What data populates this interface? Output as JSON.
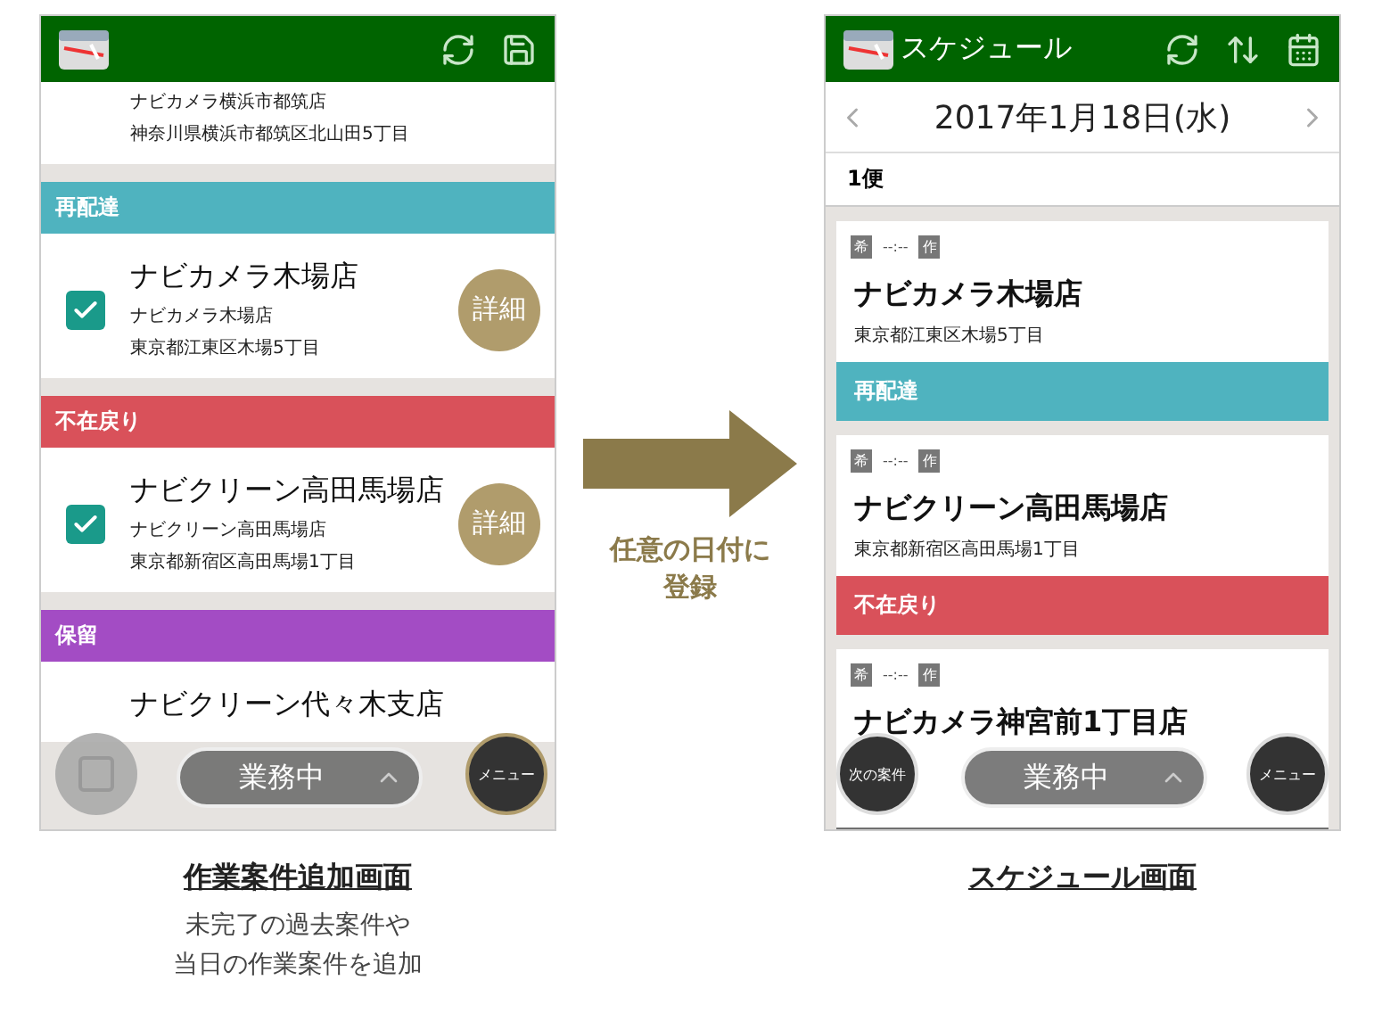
{
  "left_screen": {
    "cards": [
      {
        "name": "ナビカメラ横浜市都筑店",
        "address": "神奈川県横浜市都筑区北山田5丁目"
      },
      {
        "section": "再配達",
        "color": "#4fb3bf",
        "title": "ナビカメラ木場店",
        "name": "ナビカメラ木場店",
        "address": "東京都江東区木場5丁目",
        "checked": true,
        "detail": "詳細"
      },
      {
        "section": "不在戻り",
        "color": "#d9515a",
        "title": "ナビクリーン高田馬場店",
        "name": "ナビクリーン高田馬場店",
        "address": "東京都新宿区高田馬場1丁目",
        "checked": true,
        "detail": "詳細"
      },
      {
        "section": "保留",
        "color": "#a34cc4",
        "title": "ナビクリーン代々木支店"
      }
    ],
    "status_pill": "業務中",
    "menu_button": "メニュー"
  },
  "arrow_label": [
    "任意の日付に",
    "登録"
  ],
  "right_screen": {
    "header": {
      "title": "スケジュール"
    },
    "date": "2017年1月18日(水)",
    "trip": "1便",
    "cards": [
      {
        "tags": [
          "希",
          "--:--",
          "作"
        ],
        "title": "ナビカメラ木場店",
        "address": "東京都江東区木場5丁目",
        "status": "再配達",
        "color": "#4fb3bf"
      },
      {
        "tags": [
          "希",
          "--:--",
          "作"
        ],
        "title": "ナビクリーン高田馬場店",
        "address": "東京都新宿区高田馬場1丁目",
        "status": "不在戻り",
        "color": "#d9515a"
      },
      {
        "tags": [
          "希",
          "--:--",
          "作"
        ],
        "title": "ナビカメラ神宮前1丁目店",
        "color": "#707070"
      }
    ],
    "next_button": "次の案件",
    "status_pill": "業務中",
    "menu_button": "メニュー"
  },
  "captions": [
    {
      "title": "作業案件追加画面",
      "description": [
        "未完了の過去案件や",
        "当日の作業案件を追加"
      ]
    },
    {
      "title": "スケジュール画面"
    }
  ]
}
